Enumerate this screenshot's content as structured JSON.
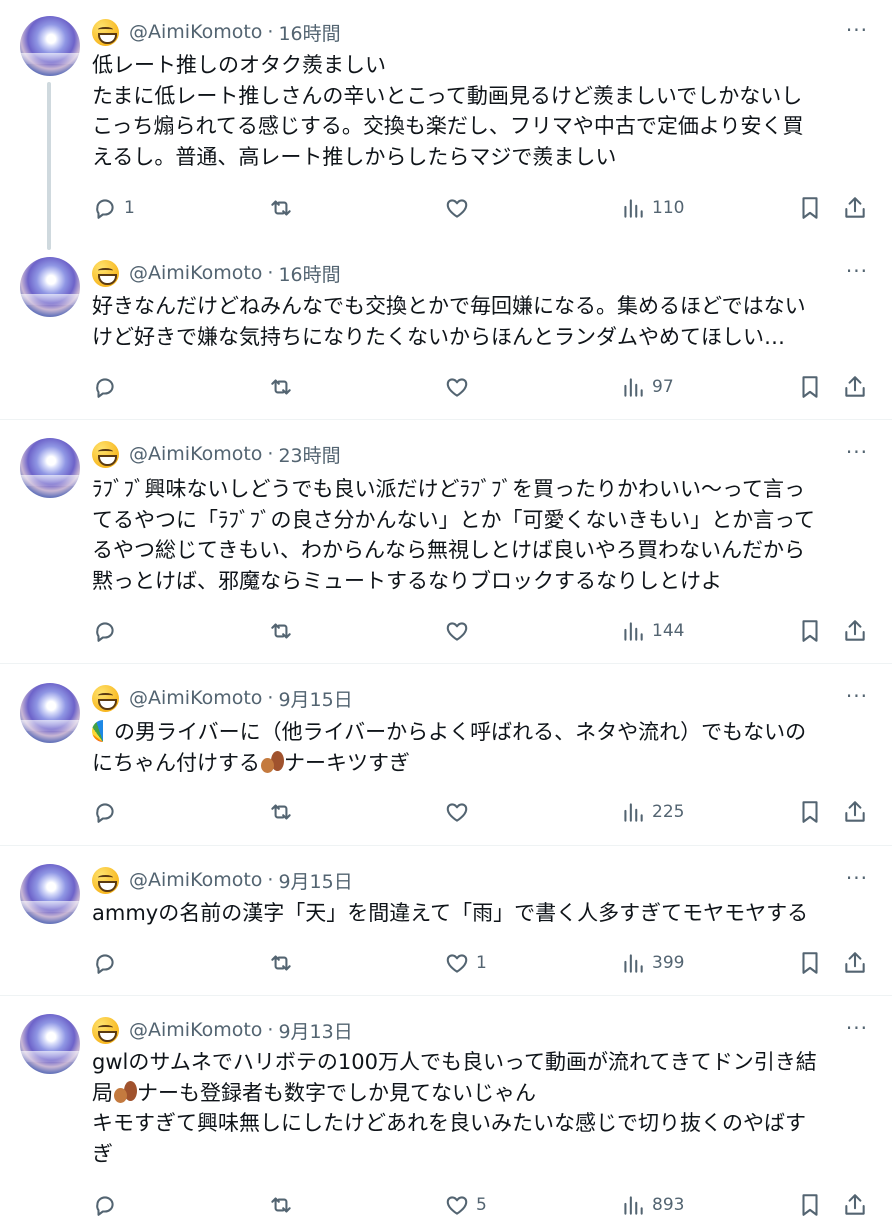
{
  "tweets": [
    {
      "handle": "@AimiKomoto",
      "time": "16時間",
      "lines": [
        "低レート推しのオタク羨ましい",
        "たまに低レート推しさんの辛いとこって動画見るけど羨ましいでしかないし",
        "こっち煽られてる感じする。交換も楽だし、フリマや中古で定価より安く買",
        "えるし。普通、高レート推しからしたらマジで羨ましい"
      ],
      "replies": "1",
      "retweets": "",
      "likes": "",
      "views": "110"
    },
    {
      "handle": "@AimiKomoto",
      "time": "16時間",
      "lines": [
        "好きなんだけどねみんなでも交換とかで毎回嫌になる。集めるほどではない",
        "けど好きで嫌な気持ちになりたくないからほんとランダムやめてほしい…"
      ],
      "replies": "",
      "retweets": "",
      "likes": "",
      "views": "97"
    },
    {
      "handle": "@AimiKomoto",
      "time": "23時間",
      "lines": [
        "ﾗﾌﾞﾌﾞ興味ないしどうでも良い派だけどﾗﾌﾞﾌﾞを買ったりかわいい〜って言っ",
        "てるやつに「ﾗﾌﾞﾌﾞの良さ分かんない」とか「可愛くないきもい」とか言って",
        "るやつ総じてきもい、わからんなら無視しとけば良いやろ買わないんだから",
        "黙っとけば、邪魔ならミュートするなりブロックするなりしとけよ"
      ],
      "replies": "",
      "retweets": "",
      "likes": "",
      "views": "144"
    },
    {
      "handle": "@AimiKomoto",
      "time": "9月15日",
      "lines": [
        "の男ライバーに（他ライバーからよく呼ばれる、ネタや流れ）でもないの",
        "にちゃん付けする",
        "ナーキツすぎ"
      ],
      "replies": "",
      "retweets": "",
      "likes": "",
      "views": "225"
    },
    {
      "handle": "@AimiKomoto",
      "time": "9月15日",
      "lines": [
        "ammyの名前の漢字「天」を間違えて「雨」で書く人多すぎてモヤモヤする"
      ],
      "replies": "",
      "retweets": "",
      "likes": "1",
      "views": "399"
    },
    {
      "handle": "@AimiKomoto",
      "time": "9月13日",
      "lines": [
        "gwlのサムネでハリボテの100万人でも良いって動画が流れてきてドン引き結",
        "局",
        "ナーも登録者も数字でしか見てないじゃん",
        "キモすぎて興味無しにしたけどあれを良いみたいな感じで切り抜くのやばす",
        "ぎ"
      ],
      "replies": "",
      "retweets": "",
      "likes": "5",
      "views": "893"
    }
  ],
  "more_glyph": "···",
  "separator": "·"
}
